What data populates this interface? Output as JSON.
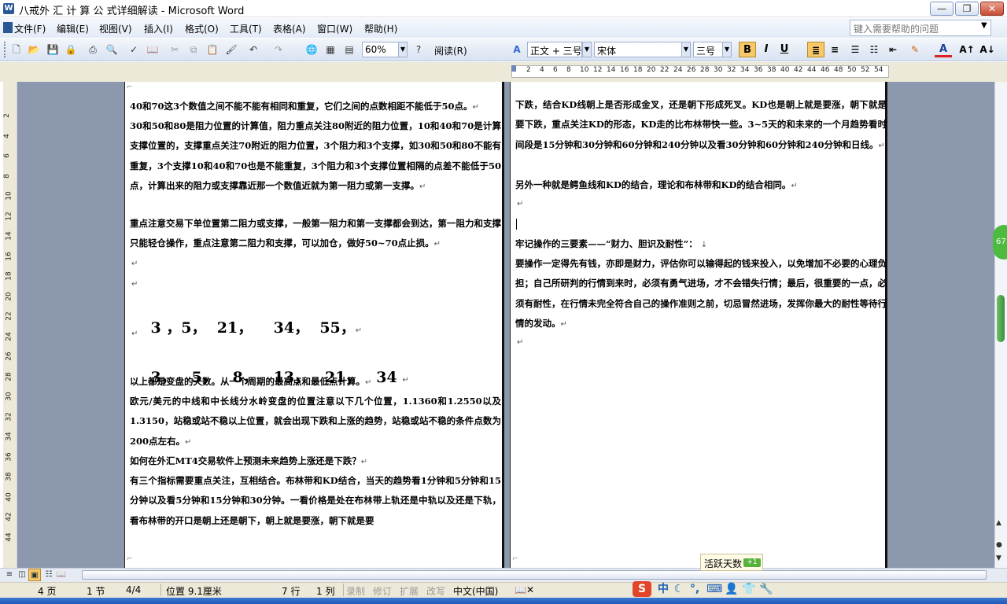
{
  "window": {
    "title": "八戒外 汇 计 算 公 式详细解读 - Microsoft Word",
    "min_glyph": "—",
    "max_glyph": "❐",
    "close_glyph": "✕"
  },
  "menu": {
    "items": [
      "文件(F)",
      "编辑(E)",
      "视图(V)",
      "插入(I)",
      "格式(O)",
      "工具(T)",
      "表格(A)",
      "窗口(W)",
      "帮助(H)"
    ],
    "help_placeholder": "键入需要帮助的问题"
  },
  "toolbar": {
    "zoom": "60%",
    "read_label": "阅读(R)",
    "style": "正文 + 三号",
    "font": "宋体",
    "size": "三号",
    "bold": "B",
    "italic": "I",
    "underline": "U",
    "font_color_glyph": "A"
  },
  "ruler": {
    "marks": [
      "2",
      "4",
      "6",
      "8",
      "10",
      "12",
      "14",
      "16",
      "18",
      "20",
      "22",
      "24",
      "26",
      "28",
      "30",
      "32",
      "34",
      "36",
      "38",
      "40",
      "42",
      "44",
      "46",
      "48",
      "50",
      "52",
      "54"
    ],
    "vmarks": [
      "2",
      "4",
      "6",
      "8",
      "10",
      "12",
      "14",
      "16",
      "18",
      "20",
      "22",
      "24",
      "26",
      "28",
      "30",
      "32",
      "34",
      "36",
      "38",
      "40",
      "42",
      "44"
    ]
  },
  "document": {
    "left": {
      "p1": "40和70这3个数值之间不能不能有相同和重复，它们之间的点数相距不能低于50点。",
      "p2": "30和50和80是阻力位置的计算值，阻力重点关注80附近的阻力位置，10和40和70是计算支撑位置的，支撑重点关注70附近的阻力位置，3个阻力和3个支撑，如30和50和80不能有重复，3个支撑10和40和70也是不能重复，3个阻力和3个支撑位置相隔的点差不能低于50点，计算出来的阻力或支撑靠近那一个数值近就为第一阻力或第一支撑。",
      "p3": "重点注意交易下单位置第二阻力或支撑，一般第一阻力和第一支撑都会到达，第一阻力和支撑只能轻仓操作，重点注意第二阻力和支撑，可以加仓，做好50~70点止损。",
      "seq1": "3 ，5，  21，    34，  55，",
      "seq2": "3，   5，   8，   13，   21，   34",
      "p4": "以上都是变盘的天数。从一个周期的最高点和最低点计算。",
      "p5": "欧元/美元的中线和中长线分水岭变盘的位置注意以下几个位置，1.1360和1.2550以及1.3150，站稳或站不稳以上位置，就会出现下跌和上涨的趋势，站稳或站不稳的条件点数为200点左右。",
      "p6": "如何在外汇MT4交易软件上预测未来趋势上涨还是下跌？",
      "p7": "有三个指标需要重点关注，互相结合。布林带和KD结合，当天的趋势看1分钟和5分钟和15分钟以及看5分钟和15分钟和30分钟。一看价格是处在布林带上轨还是中轨以及还是下轨，看布林带的开口是朝上还是朝下，朝上就是要涨，朝下就是要"
    },
    "right": {
      "p1": "下跌，结合KD线朝上是否形成金叉，还是朝下形成死叉。KD也是朝上就是要涨，朝下就是要下跌，重点关注KD的形态，KD走的比布林带快一些。3~5天的和未来的一个月趋势看时间段是15分钟和30分钟和60分钟和240分钟以及看30分钟和60分钟和240分钟和日线。",
      "p2": "另外一种就是鳄鱼线和KD的结合，理论和布林带和KD的结合相同。",
      "h1": "牢记操作的三要素——“财力、胆识及耐性”：",
      "p3": "要操作一定得先有钱，亦即是财力，评估你可以输得起的钱来投入，以免增加不必要的心理负担；自己所研判的行情到来时，必须有勇气进场，才不会错失行情；最后，很重要的一点，必须有耐性，在行情未完全符合自己的操作准则之前，切忌冒然进场，发挥你最大的耐性等待行情的发动。"
    },
    "para_mark": "↵"
  },
  "side_badge": "67",
  "status": {
    "page": "4 页",
    "section": "1 节",
    "page_of": "4/4",
    "position": "位置 9.1厘米",
    "line": "7 行",
    "col": "1 列",
    "rec": "录制",
    "trk": "修订",
    "ext": "扩展",
    "ovr": "改写",
    "lang": "中文(中国)"
  },
  "tooltip": {
    "text": "活跃天数",
    "badge": "+1"
  },
  "ime": {
    "logo": "S",
    "mode": "中"
  }
}
